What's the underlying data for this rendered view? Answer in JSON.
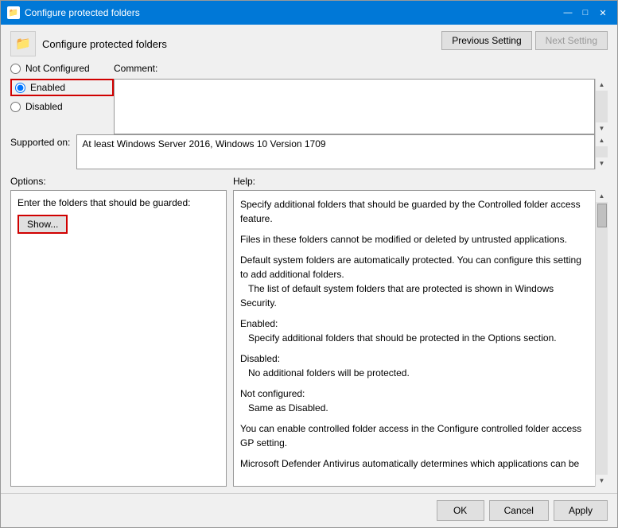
{
  "window": {
    "title": "Configure protected folders",
    "icon": "📁"
  },
  "header": {
    "title": "Configure protected folders",
    "prev_button": "Previous Setting",
    "next_button": "Next Setting"
  },
  "radio": {
    "not_configured": "Not Configured",
    "enabled": "Enabled",
    "disabled": "Disabled"
  },
  "comment": {
    "label": "Comment:"
  },
  "supported": {
    "label": "Supported on:",
    "value": "At least Windows Server 2016, Windows 10 Version 1709"
  },
  "options": {
    "label": "Options:",
    "text": "Enter the folders that should be guarded:",
    "show_button": "Show..."
  },
  "help": {
    "label": "Help:",
    "paragraphs": [
      "Specify additional folders that should be guarded by the Controlled folder access feature.",
      "Files in these folders cannot be modified or deleted by untrusted applications.",
      "Default system folders are automatically protected. You can configure this setting to add additional folders.\n    The list of default system folders that are protected is shown in Windows Security.",
      "Enabled:\n    Specify additional folders that should be protected in the Options section.",
      "Disabled:\n    No additional folders will be protected.",
      "Not configured:\n    Same as Disabled.",
      "You can enable controlled folder access in the Configure controlled folder access GP setting.",
      "Microsoft Defender Antivirus automatically determines which applications can be"
    ]
  },
  "footer": {
    "ok": "OK",
    "cancel": "Cancel",
    "apply": "Apply"
  },
  "title_controls": {
    "minimize": "—",
    "maximize": "□",
    "close": "✕"
  }
}
